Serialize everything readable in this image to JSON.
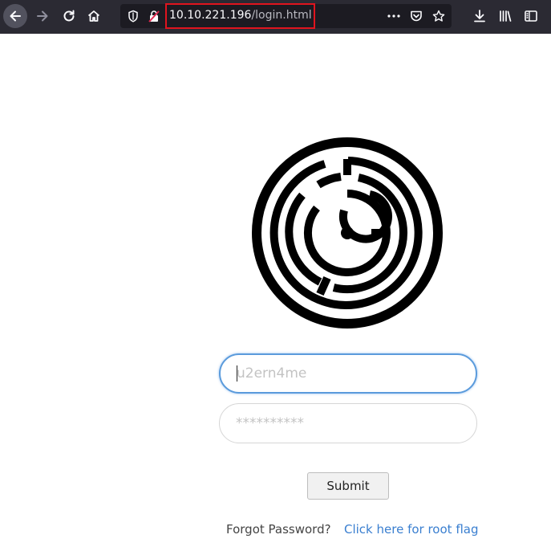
{
  "browser": {
    "url_host": "10.10.221.196",
    "url_path": "/login.html",
    "icons": [
      "back-arrow-icon",
      "forward-arrow-icon",
      "reload-icon",
      "home-icon",
      "shield-icon",
      "insecure-lock-icon",
      "more-dots-icon",
      "pocket-icon",
      "bookmark-star-icon",
      "download-icon",
      "library-icon",
      "sidebar-icon"
    ],
    "highlight_color": "#e0141e"
  },
  "login": {
    "username_placeholder": "u2ern4me",
    "password_placeholder": "**********",
    "submit_label": "Submit",
    "forgot_text": "Forgot Password?",
    "root_flag_link": "Click here for root flag"
  },
  "colors": {
    "toolbar_bg": "#2b2a33",
    "link": "#3a7fd0",
    "focus_border": "#5b9bdc"
  }
}
